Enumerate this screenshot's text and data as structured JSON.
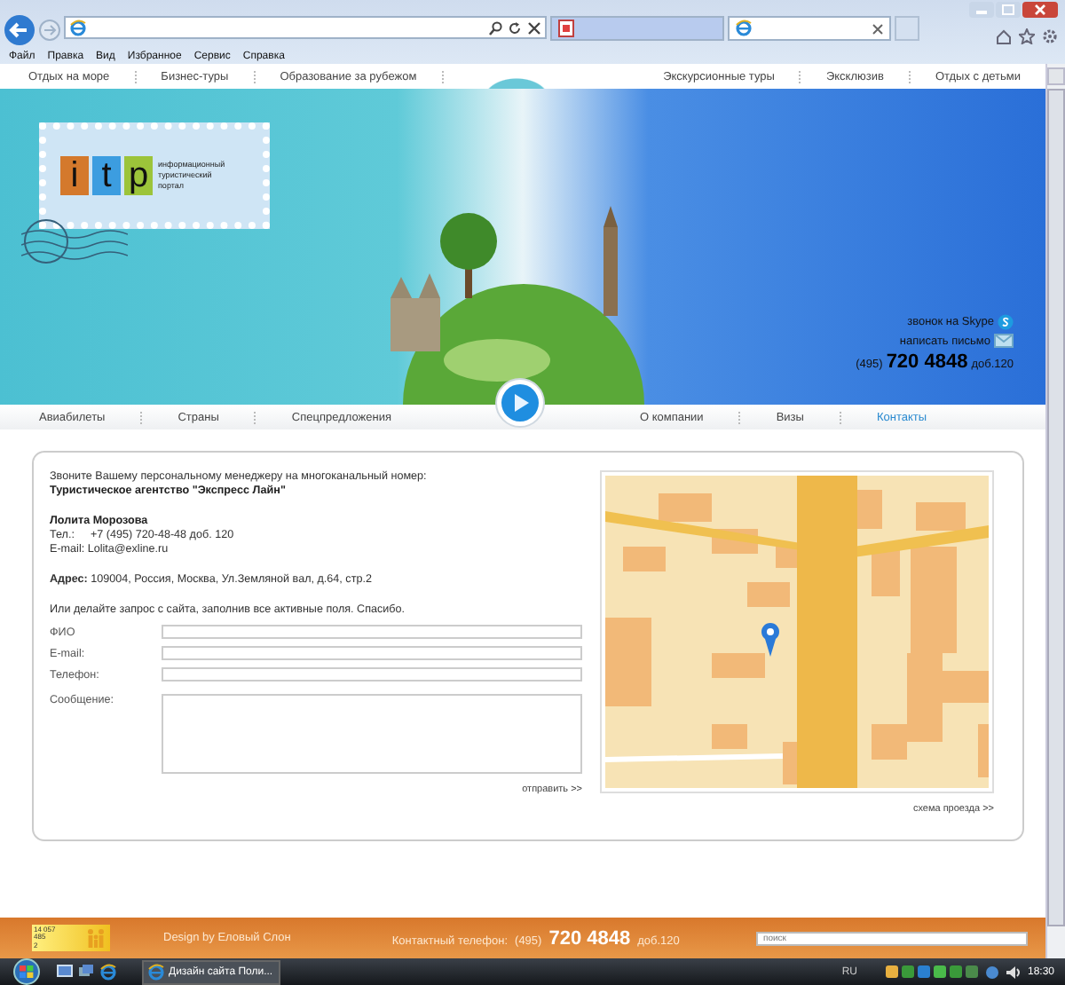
{
  "browser": {
    "tabs": [
      {
        "selected": false
      },
      {
        "selected": true
      }
    ],
    "menu": [
      "Файл",
      "Правка",
      "Вид",
      "Избранное",
      "Сервис",
      "Справка"
    ]
  },
  "top_nav": [
    {
      "label": "Отдых на море"
    },
    {
      "label": "Бизнес-туры"
    },
    {
      "label": "Образование за рубежом"
    },
    {
      "label": "Экскурсионные туры"
    },
    {
      "label": "Эксклюзив"
    },
    {
      "label": "Отдых с детьми"
    }
  ],
  "header": {
    "logo": {
      "letters": [
        {
          "char": "i",
          "color": "#d4792c"
        },
        {
          "char": "t",
          "color": "#3c9de0"
        },
        {
          "char": "p",
          "color": "#9cc43a"
        }
      ],
      "caption": "информационный туристический портал"
    },
    "contacts": {
      "skype": "звонок на Skype",
      "mail": "написать письмо",
      "phone_code": "(495)",
      "phone_number": "720 4848",
      "phone_ext": "доб.120"
    }
  },
  "main_nav": [
    {
      "label": "Авиабилеты",
      "selected": false
    },
    {
      "label": "Страны",
      "selected": false
    },
    {
      "label": "Спецпредложения",
      "selected": false
    },
    {
      "label": "О компании",
      "selected": false
    },
    {
      "label": "Визы",
      "selected": false
    },
    {
      "label": "Контакты",
      "selected": true
    }
  ],
  "contact_info": {
    "intro": "Звоните Вашему персональному менеджеру на многоканальный номер:",
    "agency": "Туристическое агентство \"Экспресс Лайн\"",
    "manager": "Лолита Морозова",
    "tel_label": "Тел.:",
    "tel_value": "+7 (495) 720-48-48 доб. 120",
    "email": "E-mail: Lolita@exline.ru",
    "address": "**Адрес:** 109004, Россия, Москва, Ул.Земляной вал, д.64, стр.2"
  },
  "form": {
    "prompt": "Или делайте запрос с сайта, заполнив все активные поля. Спасибо.",
    "fields": [
      {
        "label": "ФИО",
        "kind": "line"
      },
      {
        "label": "E-mail:",
        "kind": "line"
      },
      {
        "label": "Телефон:",
        "kind": "line"
      },
      {
        "label": "Сообщение:",
        "kind": "area"
      }
    ],
    "submit": "отправить >>"
  },
  "map": {
    "link": "схема проезда >>"
  },
  "footer": {
    "counter": [
      "14 057",
      "485",
      "2"
    ],
    "design": "Design by Еловый Слон",
    "phone_label": "Контактный телефон:",
    "phone_code": "(495)",
    "phone_number": "720 4848",
    "phone_ext": "доб.120",
    "search": {
      "placeholder": "поиск"
    }
  },
  "taskbar": {
    "window": "Дизайн сайта Поли...",
    "language": "RU",
    "time": "18:30"
  }
}
